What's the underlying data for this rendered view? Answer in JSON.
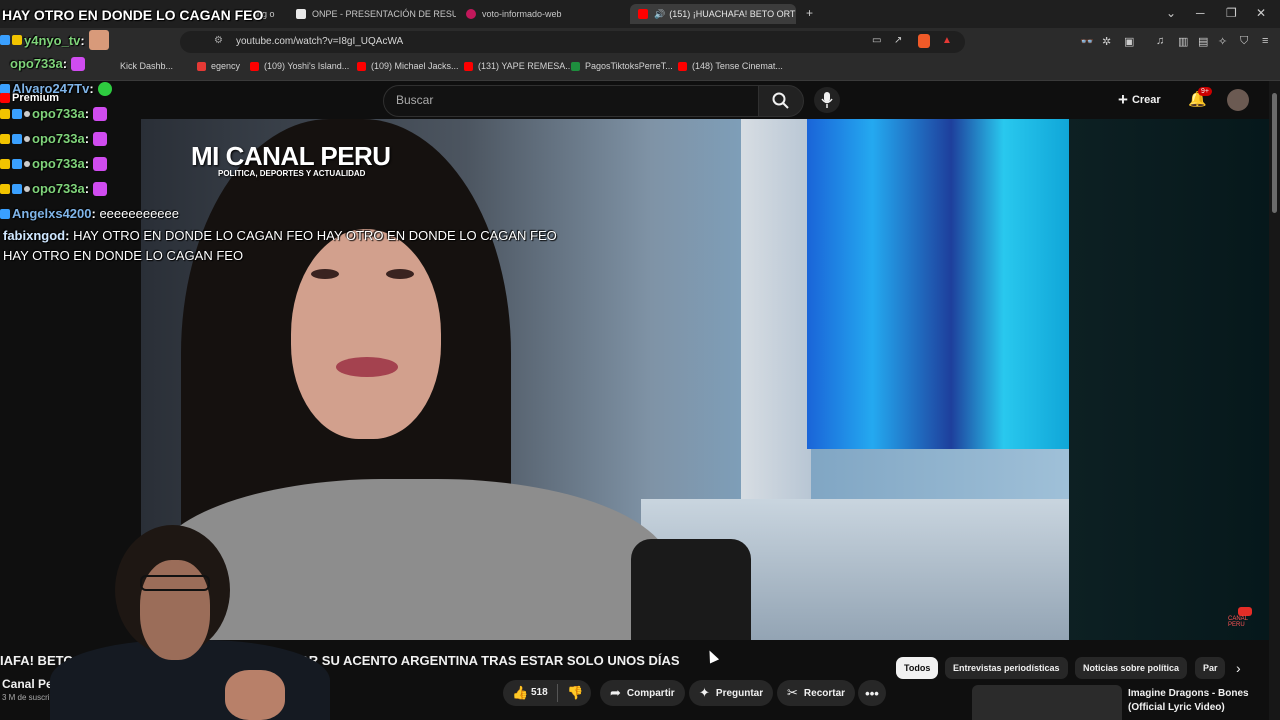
{
  "browser": {
    "tabs": [
      {
        "label": "ONPE - PRESENTACIÓN DE RESULTAD"
      },
      {
        "label": "voto-informado-web"
      },
      {
        "label": "(151) ¡HUACHAFA! BETO ORT",
        "active": true
      }
    ],
    "partial_tab_label": "ing o",
    "url": "youtube.com/watch?v=I8gI_UQAcWA",
    "bookmarks": [
      {
        "label": "Kick Dashb..."
      },
      {
        "label": "egency"
      },
      {
        "label": "(109) Yoshi's Island..."
      },
      {
        "label": "(109) Michael Jacks..."
      },
      {
        "label": "(131) YAPE REMESA..."
      },
      {
        "label": "PagosTiktoksPerreT..."
      },
      {
        "label": "(148) Tense Cinemat..."
      }
    ],
    "colors": {
      "accent": "#ff0000",
      "chrome_bg": "#1f1f1f"
    }
  },
  "youtube": {
    "premium_label": "Premium",
    "search_placeholder": "Buscar",
    "create_label": "Crear",
    "notification_count": "9+",
    "video": {
      "overlay_title": "MI CANAL PERU",
      "overlay_subtitle": "POLITICA, DEPORTES Y ACTUALIDAD",
      "watermark": "CANAL PERU"
    },
    "title_left": "IAFA! BETO ORT",
    "title_right": "POR SU ACENTO ARGENTINA TRAS ESTAR SOLO UNOS DÍAS",
    "channel_name": "Canal Peru",
    "subscribers": "3 M de suscript",
    "actions": {
      "likes": "518",
      "share": "Compartir",
      "ask": "Preguntar",
      "clip": "Recortar"
    },
    "chips": [
      "Todos",
      "Entrevistas periodísticas",
      "Noticias sobre política",
      "Par"
    ],
    "recommendation": {
      "title": "Imagine Dragons - Bones (Official Lyric Video)"
    }
  },
  "chat": {
    "top_message": "HAY OTRO EN DONDE LO CAGAN FEO",
    "messages": [
      {
        "user": "y4nyo_tv",
        "text": "",
        "color": "#7fd37a"
      },
      {
        "user": "opo733a",
        "text": "",
        "color": "#7fd37a"
      },
      {
        "user": "Alvaro247Tv",
        "text": "",
        "color": "#7fb4e8"
      },
      {
        "user": "opo733a",
        "text": "",
        "color": "#7fd37a"
      },
      {
        "user": "opo733a",
        "text": "",
        "color": "#7fd37a"
      },
      {
        "user": "opo733a",
        "text": "",
        "color": "#7fd37a"
      },
      {
        "user": "opo733a",
        "text": "",
        "color": "#7fd37a"
      },
      {
        "user": "Angelxs4200",
        "text": "eeeeeeeeeee",
        "color": "#7fb4e8"
      },
      {
        "user": "fabixngod",
        "text": "HAY OTRO EN DONDE LO CAGAN FEO HAY OTRO EN DONDE LO CAGAN FEO",
        "color": "#cfe7ff"
      }
    ],
    "wrap_line": "HAY OTRO EN DONDE LO CAGAN FEO"
  }
}
